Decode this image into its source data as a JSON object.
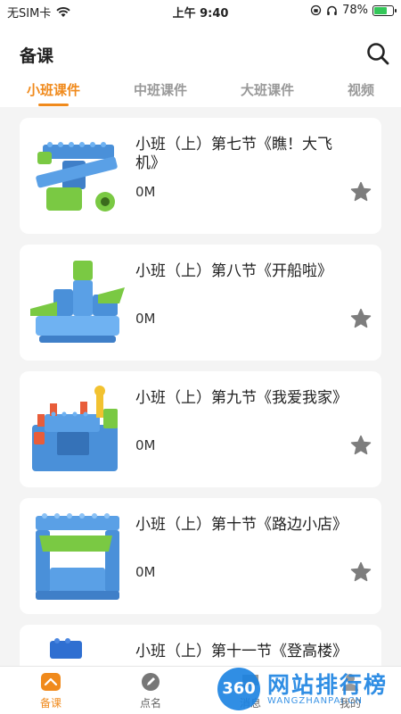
{
  "status_bar": {
    "carrier": "无SIM卡",
    "time": "上午 9:40",
    "battery": "78%",
    "battery_level": 0.78
  },
  "header": {
    "title": "备课"
  },
  "tabs": [
    {
      "label": "小班课件",
      "active": true
    },
    {
      "label": "中班课件",
      "active": false
    },
    {
      "label": "大班课件",
      "active": false
    },
    {
      "label": "视频",
      "active": false
    }
  ],
  "lessons": [
    {
      "title": "小班（上）第七节《瞧！大飞机》",
      "size": "0M"
    },
    {
      "title": "小班（上）第八节《开船啦》",
      "size": "0M"
    },
    {
      "title": "小班（上）第九节《我爱我家》",
      "size": "0M"
    },
    {
      "title": "小班（上）第十节《路边小店》",
      "size": "0M"
    },
    {
      "title": "小班（上）第十一节《登高楼》",
      "size": ""
    }
  ],
  "bottom_nav": [
    {
      "label": "备课",
      "icon": "lesson-icon",
      "active": true
    },
    {
      "label": "点名",
      "icon": "pencil-icon",
      "active": false
    },
    {
      "label": "消息",
      "icon": "message-icon",
      "active": false
    },
    {
      "label": "我的",
      "icon": "profile-icon",
      "active": false
    }
  ],
  "watermark": {
    "badge": "360",
    "text": "网站排行榜",
    "sub": "WANGZHANPAI.CN"
  },
  "colors": {
    "accent": "#f08a1c",
    "background": "#f4f4f4",
    "card": "#ffffff",
    "watermark": "#1a82e2"
  }
}
